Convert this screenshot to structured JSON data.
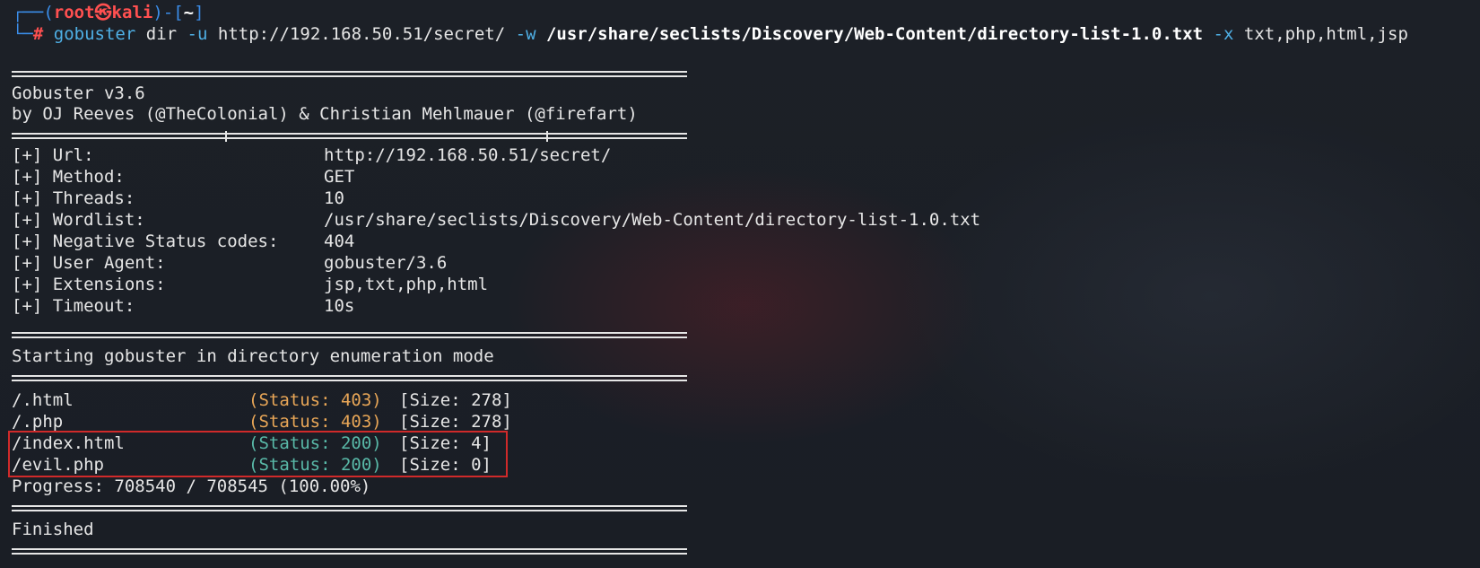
{
  "prompt": {
    "corner_top": "┌──(",
    "user": "root",
    "at_icon": "㉿",
    "host": "kali",
    "mid": ")-[",
    "path": "~",
    "close": "]",
    "corner_bottom": "└─",
    "hash": "#"
  },
  "command": {
    "program": "gobuster",
    "mode": "dir",
    "url_flag": "-u",
    "url": "http://192.168.50.51/secret/",
    "wordlist_flag": "-w",
    "wordlist": "/usr/share/seclists/Discovery/Web-Content/directory-list-1.0.txt",
    "ext_flag": "-x",
    "extensions": "txt,php,html,jsp"
  },
  "banner": {
    "version": "Gobuster v3.6",
    "authors": "by OJ Reeves (@TheColonial) & Christian Mehlmauer (@firefart)"
  },
  "config": [
    {
      "key": "[+] Url:",
      "value": "http://192.168.50.51/secret/"
    },
    {
      "key": "[+] Method:",
      "value": "GET"
    },
    {
      "key": "[+] Threads:",
      "value": "10"
    },
    {
      "key": "[+] Wordlist:",
      "value": "/usr/share/seclists/Discovery/Web-Content/directory-list-1.0.txt"
    },
    {
      "key": "[+] Negative Status codes:",
      "value": "404"
    },
    {
      "key": "[+] User Agent:",
      "value": "gobuster/3.6"
    },
    {
      "key": "[+] Extensions:",
      "value": "jsp,txt,php,html"
    },
    {
      "key": "[+] Timeout:",
      "value": "10s"
    }
  ],
  "start_message": "Starting gobuster in directory enumeration mode",
  "results": [
    {
      "path": "/.html",
      "status": "(Status: 403)",
      "size": "[Size: 278]",
      "color": "#e8a657"
    },
    {
      "path": "/.php",
      "status": "(Status: 403)",
      "size": "[Size: 278]",
      "color": "#e8a657"
    },
    {
      "path": "/index.html",
      "status": "(Status: 200)",
      "size": "[Size: 4]",
      "color": "#59b9a8"
    },
    {
      "path": "/evil.php",
      "status": "(Status: 200)",
      "size": "[Size: 0]",
      "color": "#59b9a8"
    }
  ],
  "progress": "Progress: 708540 / 708545 (100.00%)",
  "finished": "Finished",
  "colors": {
    "prompt_frame": "#3b8eea",
    "prompt_user": "#ff5050",
    "command": "#4fb0e6",
    "status_403": "#e8a657",
    "status_200": "#59b9a8",
    "highlight_box": "#d02a2a"
  }
}
